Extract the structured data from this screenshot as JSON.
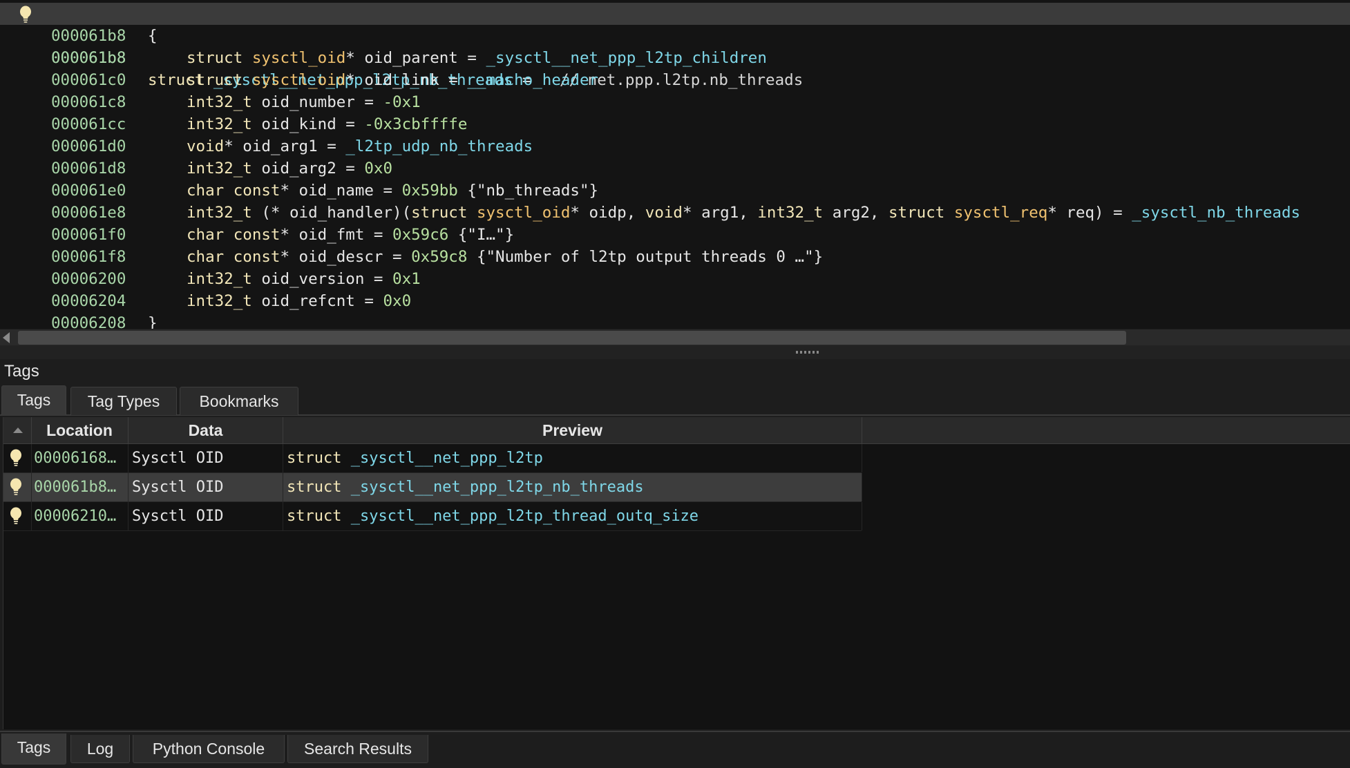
{
  "code": {
    "header": {
      "address": "000061b8",
      "keyword": "struct",
      "name": "_sysctl__net_ppp_l2tp_nb_threads",
      "eq": " =",
      "comment": "// net.ppp.l2tp.nb_threads"
    },
    "lines": [
      {
        "addr": "000061b8",
        "text": "{"
      },
      {
        "addr": "000061b8",
        "kw": "struct",
        "type": "sysctl_oid",
        "rest": "* oid_parent = ",
        "val": "_sysctl__net_ppp_l2tp_children"
      },
      {
        "addr": "000061c0",
        "kw": "struct",
        "type": "sysctl_oid",
        "rest": "* oid_link = ",
        "val": "__macho_header"
      },
      {
        "addr": "000061c8",
        "kw": "int32_t",
        "rest": " oid_number = ",
        "num": "-0x1"
      },
      {
        "addr": "000061cc",
        "kw": "int32_t",
        "rest": " oid_kind = ",
        "num": "-0x3cbffffe"
      },
      {
        "addr": "000061d0",
        "kw": "void",
        "rest": "* oid_arg1 = ",
        "val": "_l2tp_udp_nb_threads"
      },
      {
        "addr": "000061d8",
        "kw": "int32_t",
        "rest": " oid_arg2 = ",
        "num": "0x0"
      },
      {
        "addr": "000061e0",
        "kw": "char const",
        "rest": "* oid_name = ",
        "num": "0x59bb",
        "str": " {\"nb_threads\"}"
      },
      {
        "addr": "000061e8",
        "handler": true
      },
      {
        "addr": "000061f0",
        "kw": "char const",
        "rest": "* oid_fmt = ",
        "num": "0x59c6",
        "str": " {\"I…\"}"
      },
      {
        "addr": "000061f8",
        "kw": "char const",
        "rest": "* oid_descr = ",
        "num": "0x59c8",
        "str": " {\"Number of l2tp output threads 0 …\"}"
      },
      {
        "addr": "00006200",
        "kw": "int32_t",
        "rest": " oid_version = ",
        "num": "0x1"
      },
      {
        "addr": "00006204",
        "kw": "int32_t",
        "rest": " oid_refcnt = ",
        "num": "0x0"
      },
      {
        "addr": "00006208",
        "text": "}"
      }
    ],
    "handler": {
      "p1": "int32_t",
      "p2": " (* oid_handler)(",
      "p3": "struct ",
      "p4": "sysctl_oid",
      "p5": "* oidp, ",
      "p6": "void",
      "p7": "* arg1, ",
      "p8": "int32_t",
      "p9": " arg2, ",
      "p10": "struct ",
      "p11": "sysctl_req",
      "p12": "* req) = ",
      "p13": "_sysctl_nb_threads"
    }
  },
  "panel": {
    "title": "Tags",
    "tabs": [
      "Tags",
      "Tag Types",
      "Bookmarks"
    ],
    "columns": [
      "Location",
      "Data",
      "Preview"
    ],
    "rows": [
      {
        "location": "00006168…",
        "data": "Sysctl OID",
        "preview_kw": "struct",
        "preview_name": "_sysctl__net_ppp_l2tp"
      },
      {
        "location": "000061b8…",
        "data": "Sysctl OID",
        "preview_kw": "struct",
        "preview_name": "_sysctl__net_ppp_l2tp_nb_threads"
      },
      {
        "location": "00006210…",
        "data": "Sysctl OID",
        "preview_kw": "struct",
        "preview_name": "_sysctl__net_ppp_l2tp_thread_outq_size"
      }
    ]
  },
  "bottom_tabs": [
    "Tags",
    "Log",
    "Python Console",
    "Search Results"
  ],
  "colors": {
    "address": "#a9d6a9",
    "symbol": "#7fd7e8",
    "type": "#f0c270",
    "number": "#b8e0a0",
    "bulb": "#f5e6b0"
  }
}
